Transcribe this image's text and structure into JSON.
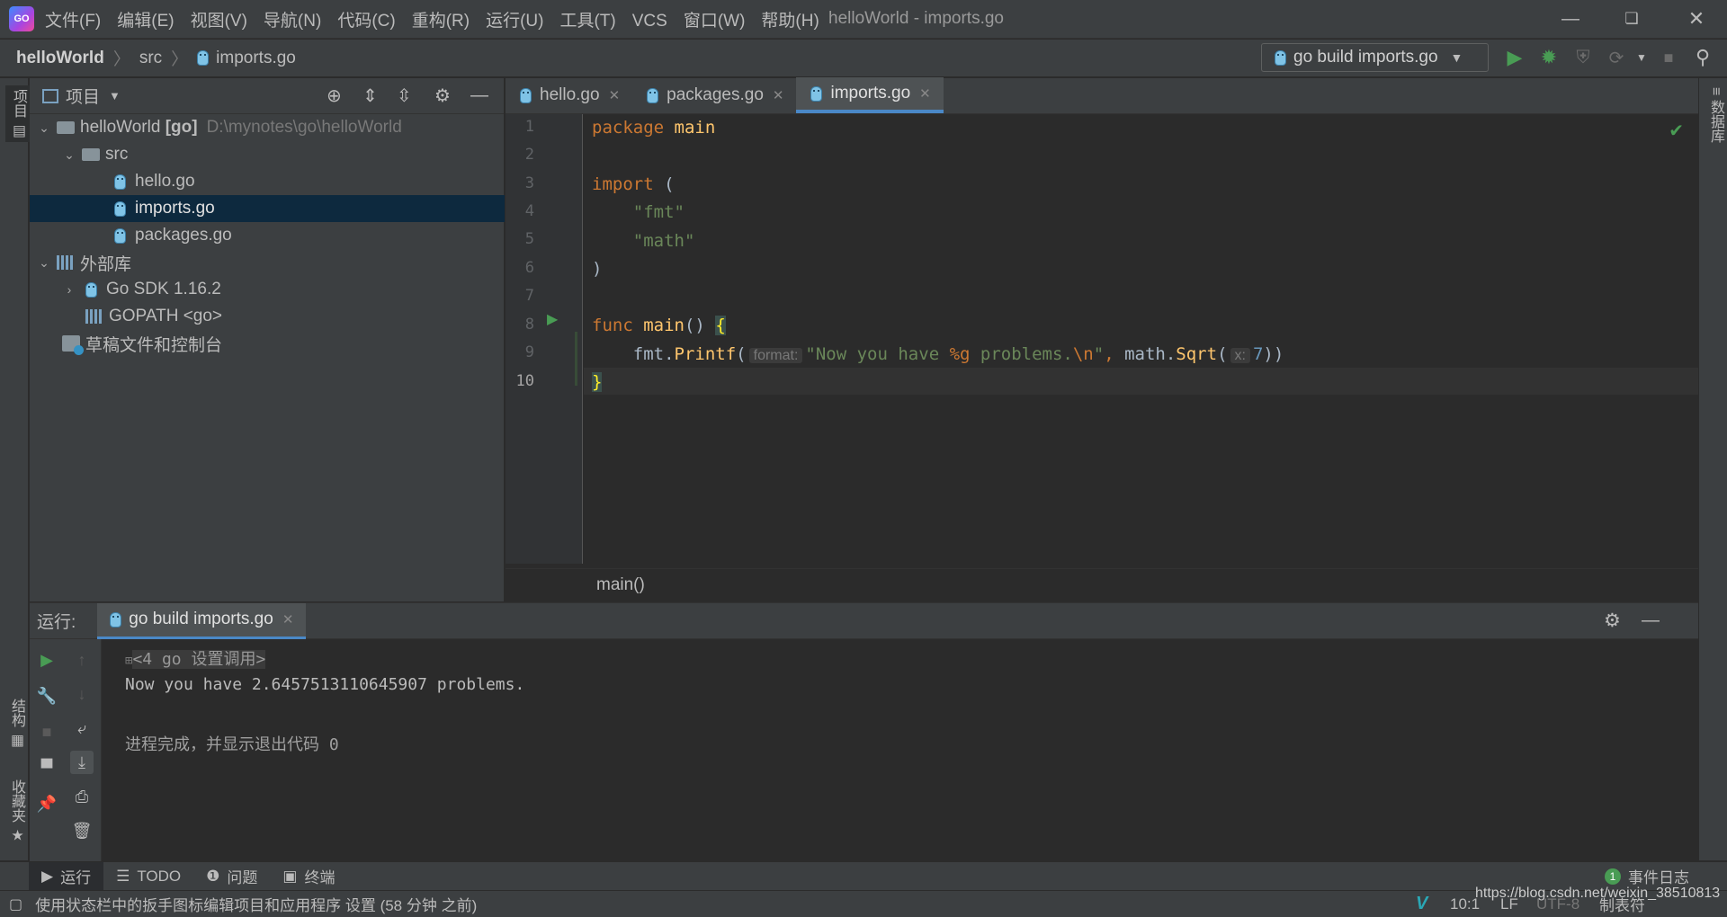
{
  "window": {
    "title": "helloWorld - imports.go",
    "app_logo_text": "GO"
  },
  "menu": [
    "文件(F)",
    "编辑(E)",
    "视图(V)",
    "导航(N)",
    "代码(C)",
    "重构(R)",
    "运行(U)",
    "工具(T)",
    "VCS",
    "窗口(W)",
    "帮助(H)"
  ],
  "breadcrumb": {
    "project": "helloWorld",
    "folder": "src",
    "file": "imports.go"
  },
  "run_config": {
    "label": "go build imports.go"
  },
  "left_strip": {
    "project_label": "项目",
    "structure_label": "结构",
    "favorites_label": "收藏夹"
  },
  "right_strip": {
    "database_label": "数据库"
  },
  "project_panel": {
    "title": "项目",
    "root": {
      "name": "helloWorld",
      "badge": "[go]",
      "path": "D:\\mynotes\\go\\helloWorld"
    },
    "src": "src",
    "files": [
      "hello.go",
      "imports.go",
      "packages.go"
    ],
    "selected": "imports.go",
    "ext_libs": "外部库",
    "sdk": "Go SDK 1.16.2",
    "gopath": "GOPATH <go>",
    "scratches": "草稿文件和控制台"
  },
  "editor": {
    "tabs": [
      {
        "label": "hello.go",
        "active": false
      },
      {
        "label": "packages.go",
        "active": false
      },
      {
        "label": "imports.go",
        "active": true
      }
    ],
    "line_numbers": [
      "1",
      "2",
      "3",
      "4",
      "5",
      "6",
      "7",
      "8",
      "9",
      "10"
    ],
    "code": {
      "l1_kw": "package",
      "l1_name": "main",
      "l3_kw": "import",
      "l3_paren": " (",
      "l4_str": "\"fmt\"",
      "l5_str": "\"math\"",
      "l6": ")",
      "l8_kw": "func",
      "l8_fn": "main",
      "l8_rest": "() ",
      "l8_brace": "{",
      "l9_recv": "fmt.",
      "l9_fn": "Printf",
      "l9_open": "(",
      "l9_hint1": "format:",
      "l9_str1": "\"Now you have ",
      "l9_fmt": "%g",
      "l9_str2": " problems.",
      "l9_esc": "\\n",
      "l9_str3": "\"",
      "l9_comma": ", ",
      "l9_recv2": "math.",
      "l9_fn2": "Sqrt",
      "l9_open2": "(",
      "l9_hint2": "x:",
      "l9_num": "7",
      "l9_close": "))",
      "l10": "}"
    },
    "breadcrumb_fn": "main()"
  },
  "run_panel": {
    "label": "运行:",
    "tab": "go build imports.go",
    "console": {
      "line1": "<4 go 设置调用>",
      "line2": "Now you have 2.6457513110645907 problems.",
      "line3": "进程完成，并显示退出代码 0"
    }
  },
  "bottom_tabs": [
    "运行",
    "TODO",
    "问题",
    "终端"
  ],
  "event_log": {
    "count": "1",
    "label": "事件日志"
  },
  "status": {
    "message": "使用状态栏中的扳手图标编辑项目和应用程序 设置 (58 分钟 之前)",
    "position": "10:1",
    "line_sep": "LF",
    "encoding": "UTF-8",
    "indent": "制表符",
    "watermark": "https://blog.csdn.net/weixin_38510813"
  },
  "colors": {
    "accent": "#4a88c7",
    "run_green": "#499c54",
    "selection": "#0d293e"
  }
}
